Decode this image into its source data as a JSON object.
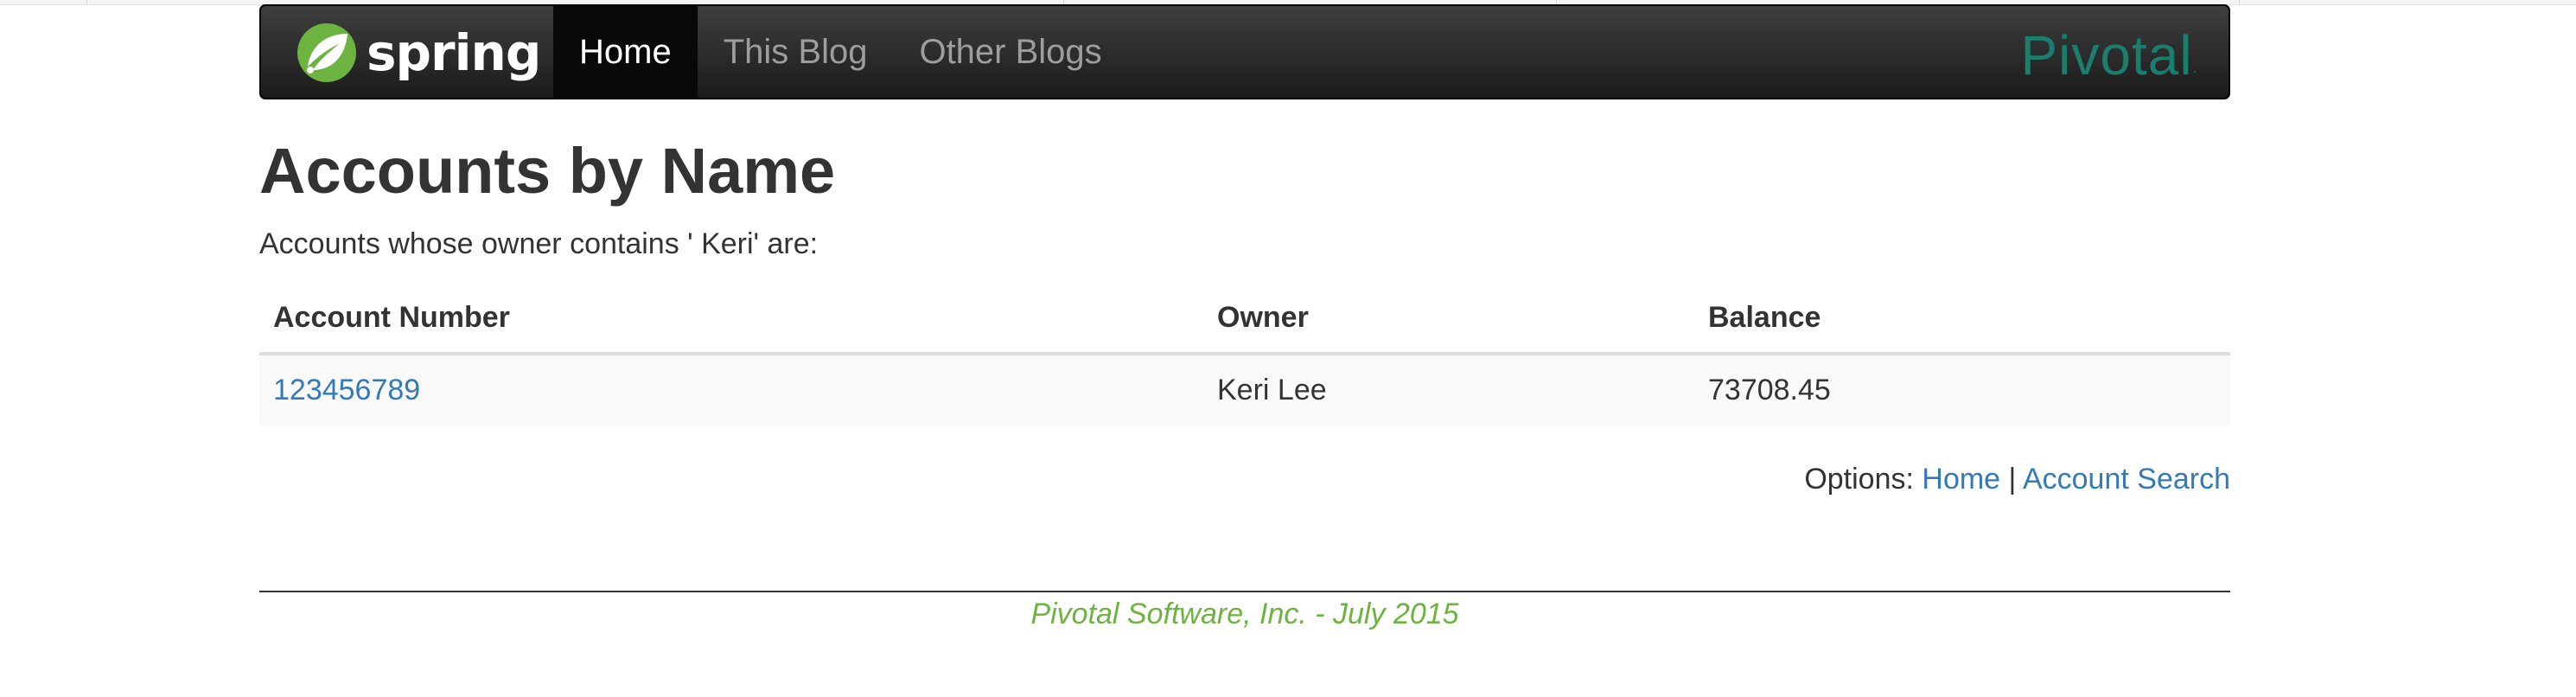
{
  "navbar": {
    "brand": "spring",
    "items": [
      {
        "label": "Home",
        "active": true
      },
      {
        "label": "This Blog",
        "active": false
      },
      {
        "label": "Other Blogs",
        "active": false
      }
    ],
    "partner_logo": "Pivotal",
    "partner_logo_mark": "."
  },
  "page": {
    "title": "Accounts by Name",
    "intro": "Accounts whose owner contains ' Keri' are:"
  },
  "table": {
    "headers": [
      "Account Number",
      "Owner",
      "Balance"
    ],
    "rows": [
      {
        "account_number": "123456789",
        "owner": "Keri Lee",
        "balance": "73708.45"
      }
    ]
  },
  "options": {
    "label": "Options:",
    "home_link": "Home",
    "separator": "|",
    "search_link": "Account Search"
  },
  "footer": {
    "text": "Pivotal Software, Inc. - July 2015"
  },
  "colors": {
    "navbar_bg": "#222222",
    "link": "#337ab7",
    "spring_green": "#6db33f",
    "pivotal_teal": "#1b7d6e"
  },
  "icons": {
    "brand_icon": "spring-leaf-icon"
  }
}
